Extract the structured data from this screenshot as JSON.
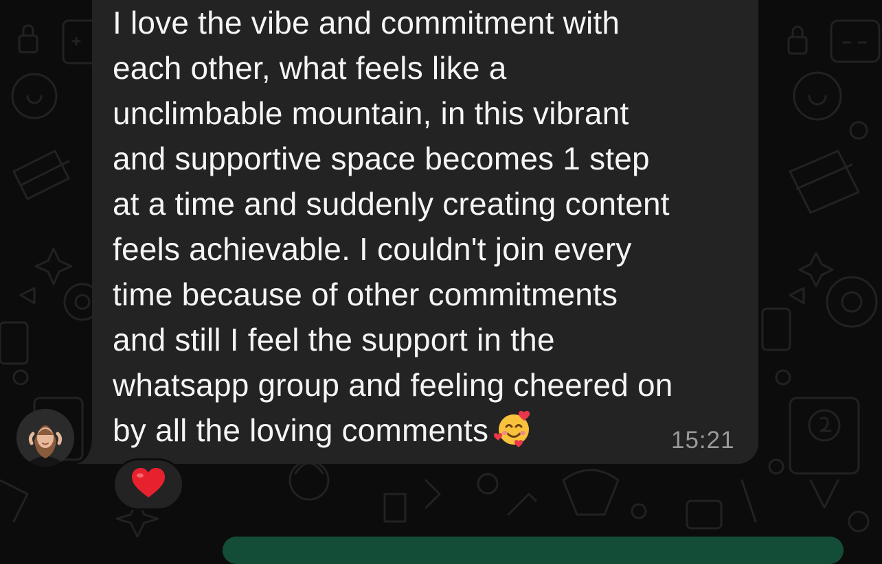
{
  "message": {
    "lines": [
      "I love the vibe and commitment with",
      "each other, what feels like a",
      "unclimbable mountain, in this vibrant",
      "and supportive space becomes 1 step",
      "at a time and suddenly creating content",
      "feels achievable. I couldn't join every",
      "time because of other commitments",
      "and still I feel the support in the",
      "whatsapp group and feeling cheered on",
      "by all the loving comments"
    ],
    "emoji": "smiling-face-with-hearts",
    "time": "15:21"
  },
  "reaction": {
    "emoji": "red-heart"
  },
  "colors": {
    "background": "#0c0c0c",
    "incoming_bubble": "#232323",
    "outgoing_bubble": "#144d37",
    "text": "#f5f5f5",
    "timestamp": "#9a9a9a"
  }
}
